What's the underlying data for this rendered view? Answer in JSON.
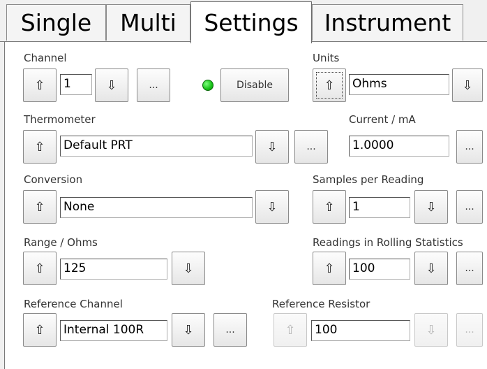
{
  "tabs": [
    {
      "label": "Single",
      "active": false
    },
    {
      "label": "Multi",
      "active": false
    },
    {
      "label": "Settings",
      "active": true
    },
    {
      "label": "Instrument",
      "active": false
    }
  ],
  "icons": {
    "up": "⇧",
    "down": "⇩",
    "more": "..."
  },
  "channel": {
    "label": "Channel",
    "value": "1",
    "status_led_color": "#1ec41e",
    "disable_label": "Disable"
  },
  "units": {
    "label": "Units",
    "value": "Ohms"
  },
  "thermometer": {
    "label": "Thermometer",
    "value": "Default PRT"
  },
  "current": {
    "label": "Current / mA",
    "value": "1.0000"
  },
  "conversion": {
    "label": "Conversion",
    "value": "None"
  },
  "samples": {
    "label": "Samples per Reading",
    "value": "1"
  },
  "range": {
    "label": "Range / Ohms",
    "value": "125"
  },
  "rolling": {
    "label": "Readings in Rolling Statistics",
    "value": "100"
  },
  "ref_channel": {
    "label": "Reference Channel",
    "value": "Internal 100R"
  },
  "ref_resistor": {
    "label": "Reference Resistor",
    "value": "100"
  }
}
